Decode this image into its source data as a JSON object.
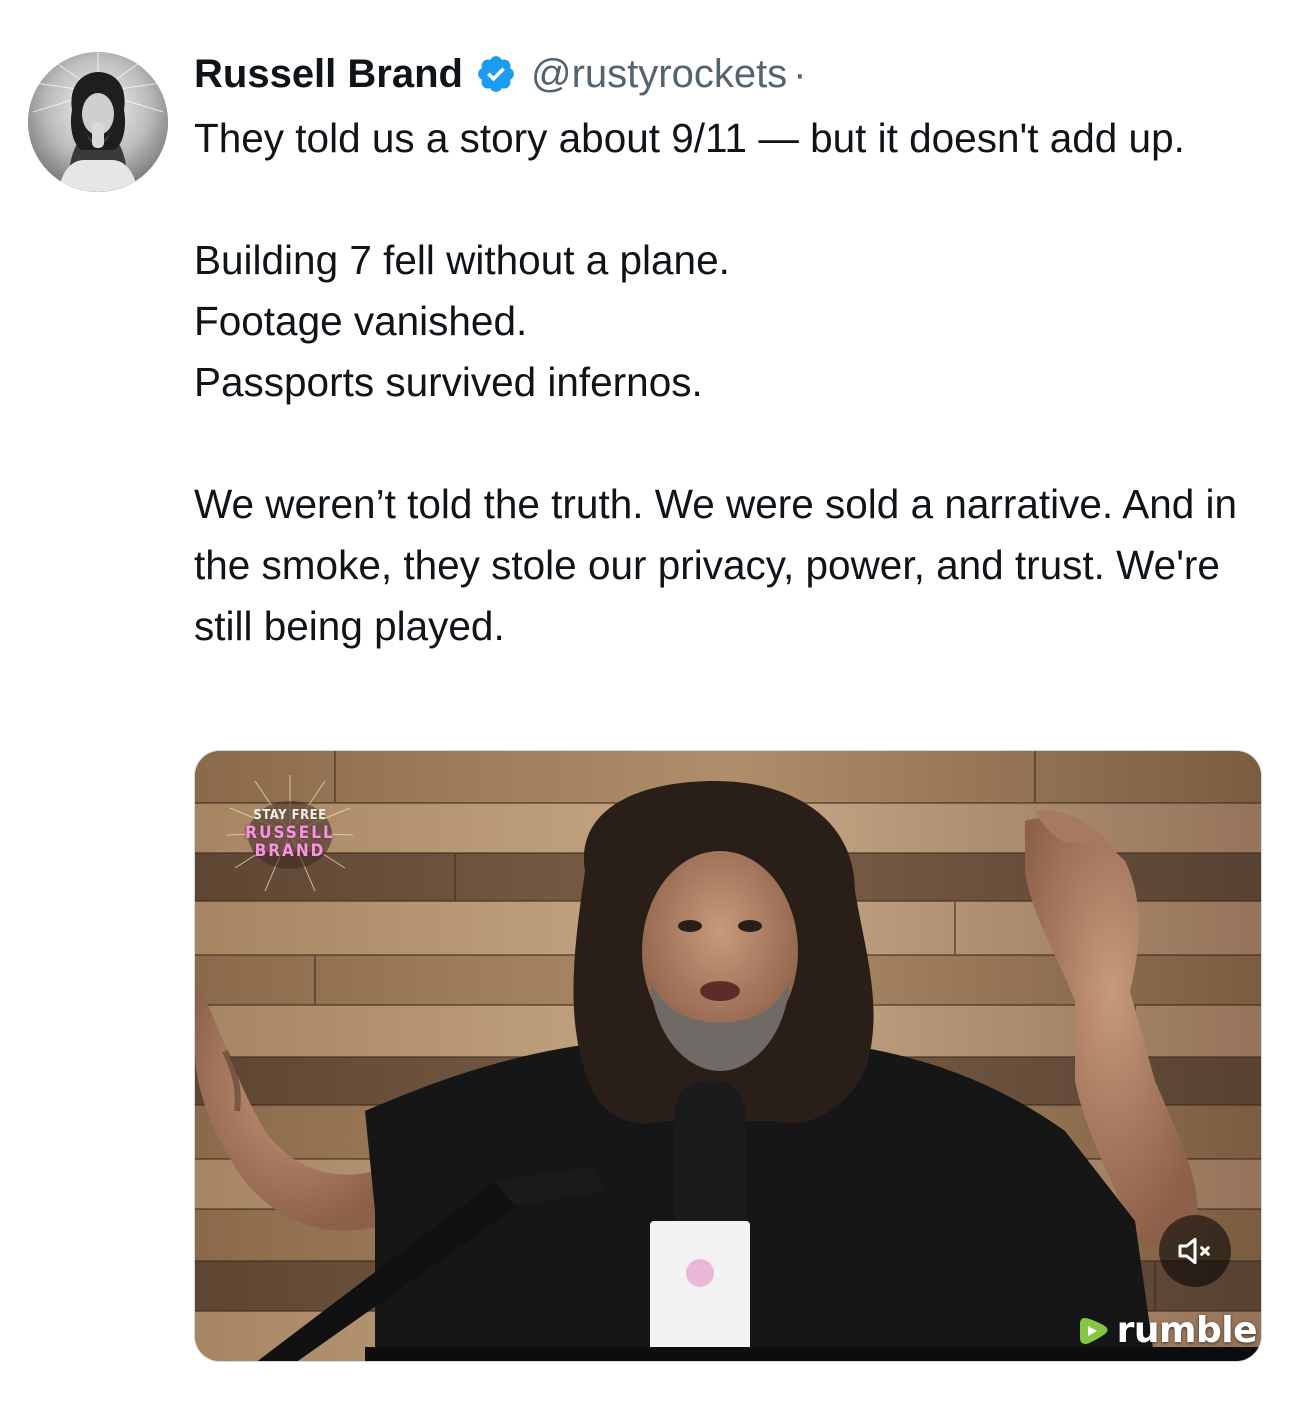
{
  "author": {
    "display_name": "Russell Brand",
    "handle": "@rustyrockets",
    "separator": "·",
    "verified": true,
    "avatar_icon": "profile-photo"
  },
  "tweet": {
    "paragraphs": [
      [
        "They told us a story about 9/11 — but it doesn't add up."
      ],
      [
        "Building 7 fell without a plane.",
        "Footage vanished.",
        "Passports survived infernos."
      ],
      [
        "We weren’t told the truth. We were sold a narrative. And in the smoke, they stole our privacy, power, and trust. We're still being played."
      ]
    ]
  },
  "media": {
    "type": "video",
    "watermark": {
      "line1": "STAY FREE",
      "line2": "RUSSELL",
      "line3": "BRAND"
    },
    "mute_icon": "speaker-muted-icon",
    "provider_logo": "rumble"
  },
  "colors": {
    "text": "#0f1419",
    "secondary_text": "#536471",
    "verified": "#1d9bf0",
    "rumble_green": "#85c742"
  }
}
